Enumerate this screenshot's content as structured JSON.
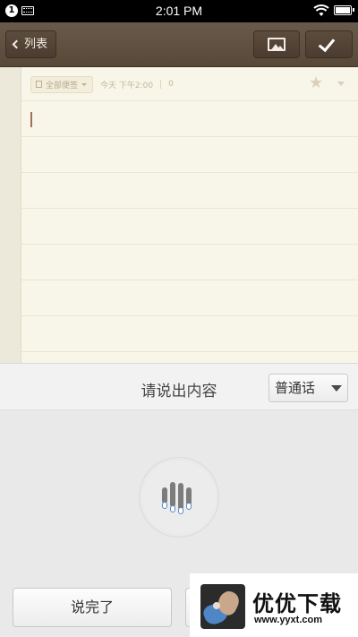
{
  "status_bar": {
    "notification_count": "1",
    "time": "2:01 PM",
    "icons": [
      "keyboard-icon",
      "wifi-icon",
      "battery-icon"
    ]
  },
  "toolbar": {
    "back_label": "列表",
    "image_button_icon": "image-icon",
    "done_button_icon": "checkmark-icon"
  },
  "note": {
    "folder_label": "全部便签",
    "date_label": "今天 下午2:00",
    "word_count": "0",
    "star_icon": "star-icon",
    "body_text": ""
  },
  "voice_input": {
    "prompt": "请说出内容",
    "language": "普通话",
    "finish_label": "说完了",
    "cancel_label": ""
  },
  "watermark": {
    "title": "优优下载",
    "url": "www.yyxt.com"
  },
  "colors": {
    "toolbar": "#5f4f40",
    "paper": "#f8f6e8",
    "panel": "#e9e9e9",
    "mic_accent": "#5a86c6"
  }
}
